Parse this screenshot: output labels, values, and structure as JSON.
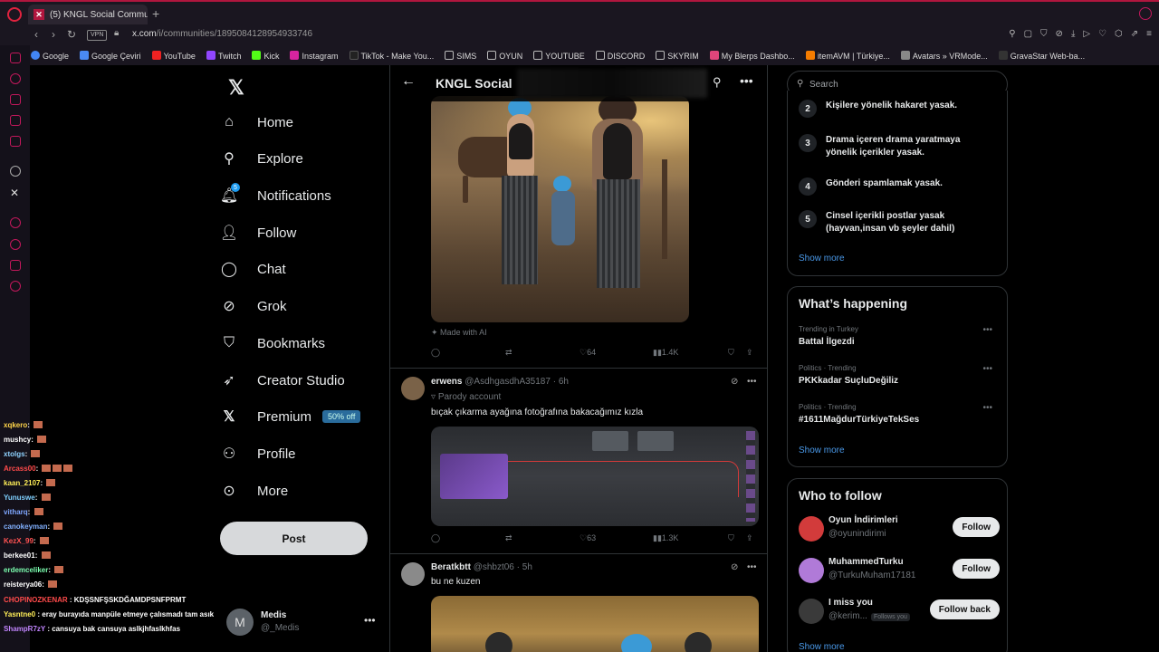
{
  "browser": {
    "tab_title": "(5) KNGL Social Communi",
    "new_tab": "+",
    "url_host": "x.com",
    "url_path": "/i/communities/1895084128954933746",
    "vpn": "VPN",
    "bookmarks": [
      "Google",
      "Google Çeviri",
      "YouTube",
      "Twitch",
      "Kick",
      "Instagram",
      "TikTok - Make You...",
      "SIMS",
      "OYUN",
      "YOUTUBE",
      "DISCORD",
      "SKYRIM",
      "My Blerps Dashbo...",
      "itemAVM | Türkiye...",
      "Avatars » VRMode...",
      "GravaStar Web-ba..."
    ]
  },
  "chat": [
    {
      "user": "xqkero",
      "msg": "",
      "color": "#ffd54a"
    },
    {
      "user": "mushcy",
      "msg": "",
      "color": "#ffffff"
    },
    {
      "user": "xtolgs",
      "msg": "",
      "color": "#8fd3ff"
    },
    {
      "user": "Arcass00",
      "msg": "",
      "color": "#ff4b4b"
    },
    {
      "user": "kaan_2107",
      "msg": "",
      "color": "#ffee58"
    },
    {
      "user": "Yunuswe",
      "msg": "",
      "color": "#7fd0ff"
    },
    {
      "user": "vitharq",
      "msg": "",
      "color": "#7fa7ff"
    },
    {
      "user": "canokeyman",
      "msg": "",
      "color": "#82b1ff"
    },
    {
      "user": "KezX_99",
      "msg": "",
      "color": "#ff5252"
    },
    {
      "user": "berkee01",
      "msg": "",
      "color": "#ffffff"
    },
    {
      "user": "erdemceliker",
      "msg": "",
      "color": "#7cffb0"
    },
    {
      "user": "reisterya06",
      "msg": "",
      "color": "#ffffff"
    },
    {
      "user": "CHOPINOZKENAR",
      "msg": "KDŞSNFŞSKDĞAMDPSNFPRMT",
      "color": "#ff4b4b"
    },
    {
      "user": "Yasntne0",
      "msg": "eray burayıda manpüle etmeye çalısmadı tam asık",
      "color": "#ffee58"
    },
    {
      "user": "ShampR7zY",
      "msg": "cansuya bak cansuya aslkjhfaslkhfas",
      "color": "#c084fc"
    }
  ],
  "nav": {
    "items": [
      {
        "label": "Home",
        "icon": "home-icon"
      },
      {
        "label": "Explore",
        "icon": "search-icon"
      },
      {
        "label": "Notifications",
        "icon": "bell-icon",
        "badge": "5"
      },
      {
        "label": "Follow",
        "icon": "follow-icon"
      },
      {
        "label": "Chat",
        "icon": "chat-icon"
      },
      {
        "label": "Grok",
        "icon": "grok-icon"
      },
      {
        "label": "Bookmarks",
        "icon": "bookmark-icon"
      },
      {
        "label": "Creator Studio",
        "icon": "rocket-icon"
      },
      {
        "label": "Premium",
        "icon": "x-icon",
        "tag": "50% off"
      },
      {
        "label": "Profile",
        "icon": "profile-icon"
      },
      {
        "label": "More",
        "icon": "more-icon"
      }
    ],
    "post_label": "Post",
    "account": {
      "name": "Medis",
      "handle": "@_Medis",
      "initial": "M"
    }
  },
  "feed": {
    "header": "KNGL Social",
    "tweet1": {
      "made_with": "Made with AI",
      "likes": "64",
      "views": "1.4K"
    },
    "tweet2": {
      "name": "erwens",
      "handle": "@AsdhgasdhA35187",
      "time": "6h",
      "parody": "Parody account",
      "text": "bıçak çıkarma ayağına fotoğrafına bakacağımız kızla",
      "likes": "63",
      "views": "1.3K"
    },
    "tweet3": {
      "name": "Beratkbtt",
      "handle": "@shbzt06",
      "time": "5h",
      "text": "bu ne kuzen"
    }
  },
  "rules": {
    "items": [
      {
        "n": "2",
        "text": "Kişilere yönelik hakaret yasak."
      },
      {
        "n": "3",
        "text": "Drama içeren drama yaratmaya yönelik içerikler yasak."
      },
      {
        "n": "4",
        "text": "Gönderi spamlamak yasak."
      },
      {
        "n": "5",
        "text": "Cinsel içerikli postlar yasak (hayvan,insan vb şeyler dahil)"
      }
    ],
    "show_more": "Show more"
  },
  "search": {
    "placeholder": "Search"
  },
  "whats_happening": {
    "title": "What’s happening",
    "trends": [
      {
        "meta": "Trending in Turkey",
        "title": "Battal İlgezdi"
      },
      {
        "meta": "Politics · Trending",
        "title": "PKKkadar SuçluDeğiliz"
      },
      {
        "meta": "Politics · Trending",
        "title": "#1611MağdurTürkiyeTekSes"
      }
    ],
    "show_more": "Show more"
  },
  "who_to_follow": {
    "title": "Who to follow",
    "users": [
      {
        "name": "Oyun İndirimleri",
        "handle": "@oyunindirimi",
        "button": "Follow",
        "color": "#d23b3b"
      },
      {
        "name": "MuhammedTurku",
        "handle": "@TurkuMuham17181",
        "button": "Follow",
        "color": "#b07ad8"
      },
      {
        "name": "I miss you",
        "handle": "@kerim...",
        "tag": "Follows you",
        "button": "Follow back",
        "color": "#3a3a3a"
      }
    ],
    "show_more": "Show more"
  }
}
